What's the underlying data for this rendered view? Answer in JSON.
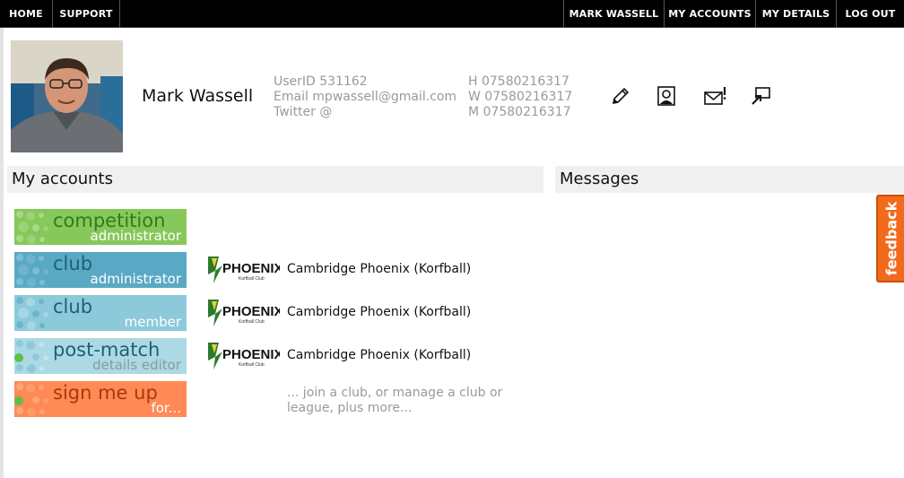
{
  "nav": {
    "home": "HOME",
    "support": "SUPPORT",
    "user_name": "MARK WASSELL",
    "my_accounts": "MY ACCOUNTS",
    "my_details": "MY DETAILS",
    "log_out": "LOG OUT"
  },
  "profile": {
    "name": "Mark Wassell",
    "user_id": "UserID 531162",
    "email": "Email mpwassell@gmail.com",
    "twitter": "Twitter @",
    "phone_home": "H 07580216317",
    "phone_work": "W 07580216317",
    "phone_mobile": "M 07580216317",
    "actions": [
      "edit-icon",
      "profile-card-icon",
      "message-alert-icon",
      "switch-account-icon"
    ]
  },
  "sections": {
    "my_accounts": "My accounts",
    "messages": "Messages"
  },
  "roles": [
    {
      "main": "competition",
      "sub": "administrator",
      "color": "#86c85a"
    },
    {
      "main": "club",
      "sub": "administrator",
      "color": "#5aa9c4"
    },
    {
      "main": "club",
      "sub": "member",
      "color": "#8ccadb"
    },
    {
      "main": "post-match",
      "sub": "details editor",
      "color": "#acd9e3"
    },
    {
      "main": "sign me up",
      "sub": "for...",
      "color": "#ff8a55"
    }
  ],
  "clubs": [
    {
      "logo_text": "PHOENIX",
      "logo_sub": "Korfball Club",
      "name": "Cambridge Phoenix (Korfball)"
    },
    {
      "logo_text": "PHOENIX",
      "logo_sub": "Korfball Club",
      "name": "Cambridge Phoenix (Korfball)"
    },
    {
      "logo_text": "PHOENIX",
      "logo_sub": "Korfball Club",
      "name": "Cambridge Phoenix (Korfball)"
    }
  ],
  "join_text": "... join a club, or manage a club or league, plus more...",
  "feedback": "feedback"
}
